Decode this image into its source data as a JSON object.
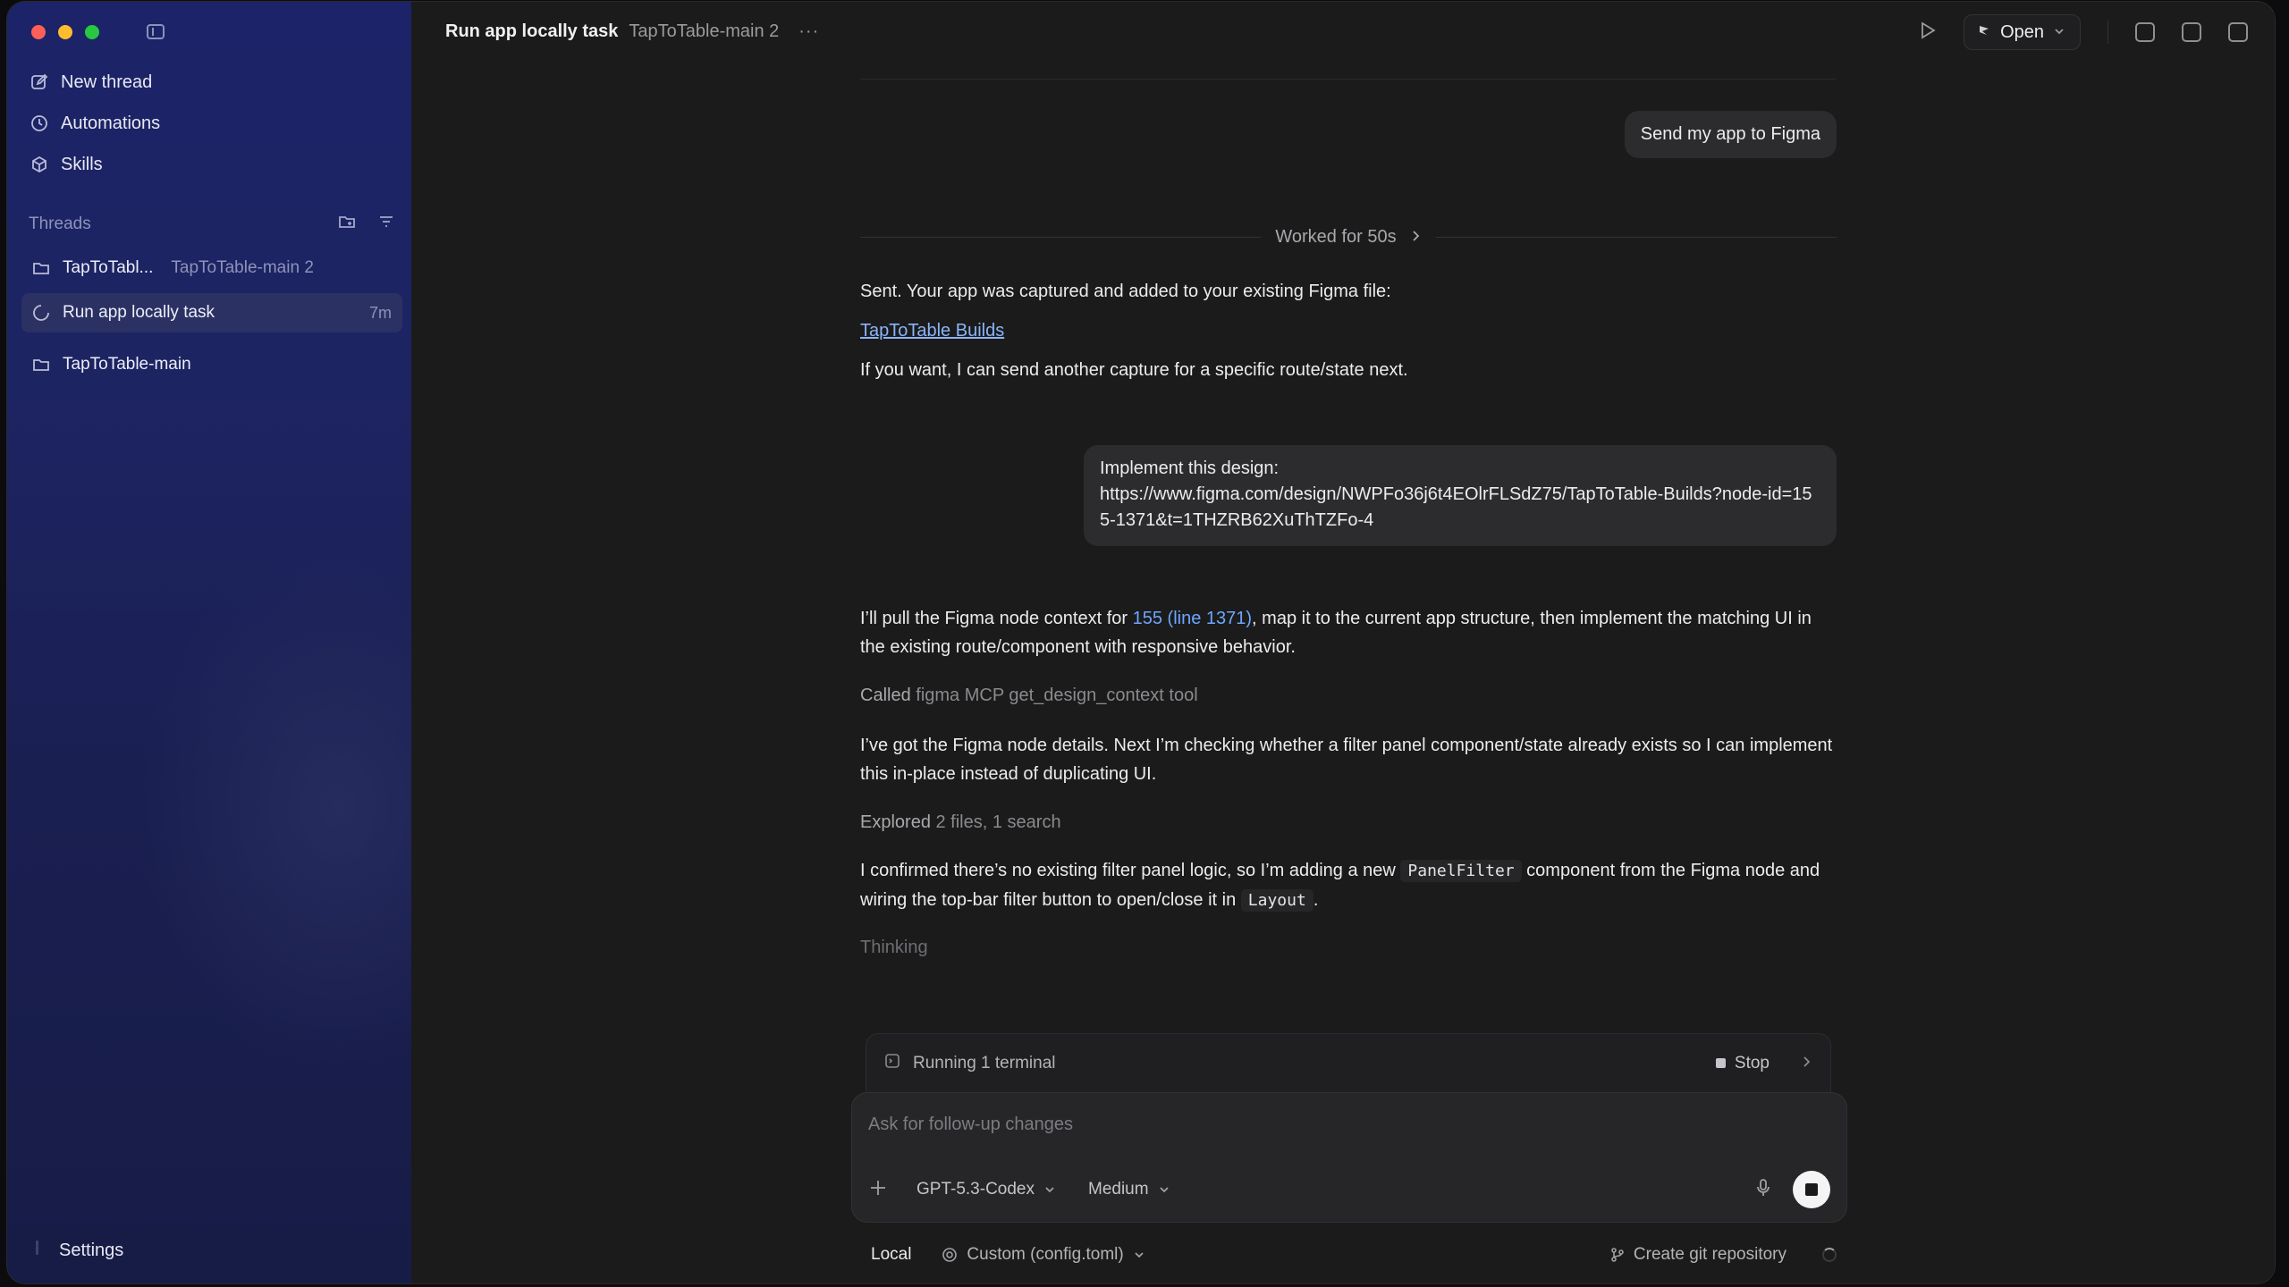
{
  "sidebar": {
    "nav": [
      {
        "label": "New thread",
        "icon": "edit-icon"
      },
      {
        "label": "Automations",
        "icon": "clock-icon"
      },
      {
        "label": "Skills",
        "icon": "cube-icon"
      }
    ],
    "threads_heading": "Threads",
    "threads": [
      {
        "name": "TapToTabl...",
        "sub": "TapToTable-main 2"
      },
      {
        "name": "Run app locally task",
        "time": "7m"
      },
      {
        "name": "TapToTable-main"
      }
    ],
    "settings_label": "Settings"
  },
  "topbar": {
    "title": "Run app locally task",
    "project": "TapToTable-main 2",
    "more": "···",
    "open_label": "Open"
  },
  "conversation": {
    "user_msg_1": "Send my app to Figma",
    "worked_label": "Worked for 50s",
    "reply_1": "Sent. Your app was captured and added to your existing Figma file:",
    "reply_1_link": "TapToTable Builds",
    "reply_1_follow": "If you want, I can send another capture for a specific route/state next.",
    "user_msg_2_line1": "Implement this design:",
    "user_msg_2_line2": "https://www.figma.com/design/NWPFo36j6t4EOlrFLSdZ75/TapToTable-Builds?node-id=155-1371&t=1THZRB62XuThTZFo-4",
    "reply_2_a": "I’ll pull the Figma node context for ",
    "reply_2_link": "155 (line 1371)",
    "reply_2_b": ", map it to the current app structure, then implement the matching UI in the existing route/component with responsive behavior.",
    "called_label": "Called",
    "called_detail": "figma MCP get_design_context tool",
    "reply_3": "I’ve got the Figma node details. Next I’m checking whether a filter panel component/state already exists so I can implement this in-place instead of duplicating UI.",
    "explored_label": "Explored",
    "explored_detail": "2 files, 1 search",
    "reply_4_a": "I confirmed there’s no existing filter panel logic, so I’m adding a new ",
    "reply_4_code1": "PanelFilter",
    "reply_4_b": " component from the Figma node and wiring the top-bar filter button to open/close it in ",
    "reply_4_code2": "Layout",
    "reply_4_c": ".",
    "thinking": "Thinking"
  },
  "composer": {
    "terminal_label": "Running 1 terminal",
    "stop_label": "Stop",
    "placeholder": "Ask for follow-up changes",
    "model": "GPT-5.3-Codex",
    "effort": "Medium"
  },
  "footer": {
    "local": "Local",
    "config": "Custom (config.toml)",
    "git": "Create git repository"
  }
}
